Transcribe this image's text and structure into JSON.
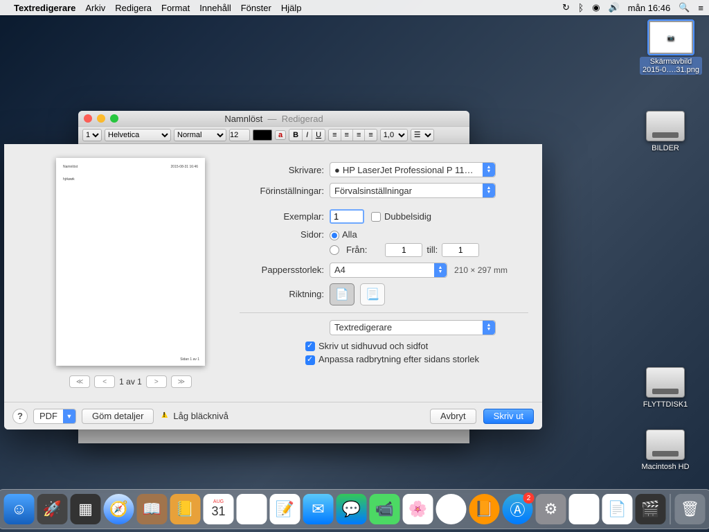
{
  "menubar": {
    "app_name": "Textredigerare",
    "items": [
      "Arkiv",
      "Redigera",
      "Format",
      "Innehåll",
      "Fönster",
      "Hjälp"
    ],
    "clock": "mån 16:46"
  },
  "desktop": {
    "screenshot": {
      "label": "Skärmavbild 2015-0….31.png"
    },
    "drive_bilder": {
      "label": "BILDER"
    },
    "drive_flytt": {
      "label": "FLYTTDISK1"
    },
    "drive_hd": {
      "label": "Macintosh HD"
    }
  },
  "textedit": {
    "title": "Namnlöst",
    "title_suffix": "Redigerad",
    "font": "Helvetica",
    "style": "Normal",
    "size": "12",
    "spacing": "1,0"
  },
  "print": {
    "labels": {
      "printer": "Skrivare:",
      "presets": "Förinställningar:",
      "copies": "Exemplar:",
      "two_sided": "Dubbelsidig",
      "pages": "Sidor:",
      "all": "Alla",
      "from": "Från:",
      "to": "till:",
      "paper_size": "Pappersstorlek:",
      "orientation": "Riktning:",
      "header_footer": "Skriv ut sidhuvud och sidfot",
      "rewrap": "Anpassa radbrytning efter sidans storlek",
      "hide_details": "Göm detaljer",
      "low_ink": "Låg bläcknivå",
      "cancel": "Avbryt",
      "print": "Skriv ut",
      "pdf": "PDF"
    },
    "values": {
      "printer": "HP LaserJet Professional P 11…",
      "preset": "Förvalsinställningar",
      "copies": "1",
      "from": "1",
      "to": "1",
      "paper": "A4",
      "paper_dims": "210 × 297 mm",
      "app_dropdown": "Textredigerare",
      "page_indicator": "1 av 1"
    }
  },
  "dock": {
    "appstore_badge": "2",
    "cal_month": "AUG",
    "cal_day": "31"
  }
}
